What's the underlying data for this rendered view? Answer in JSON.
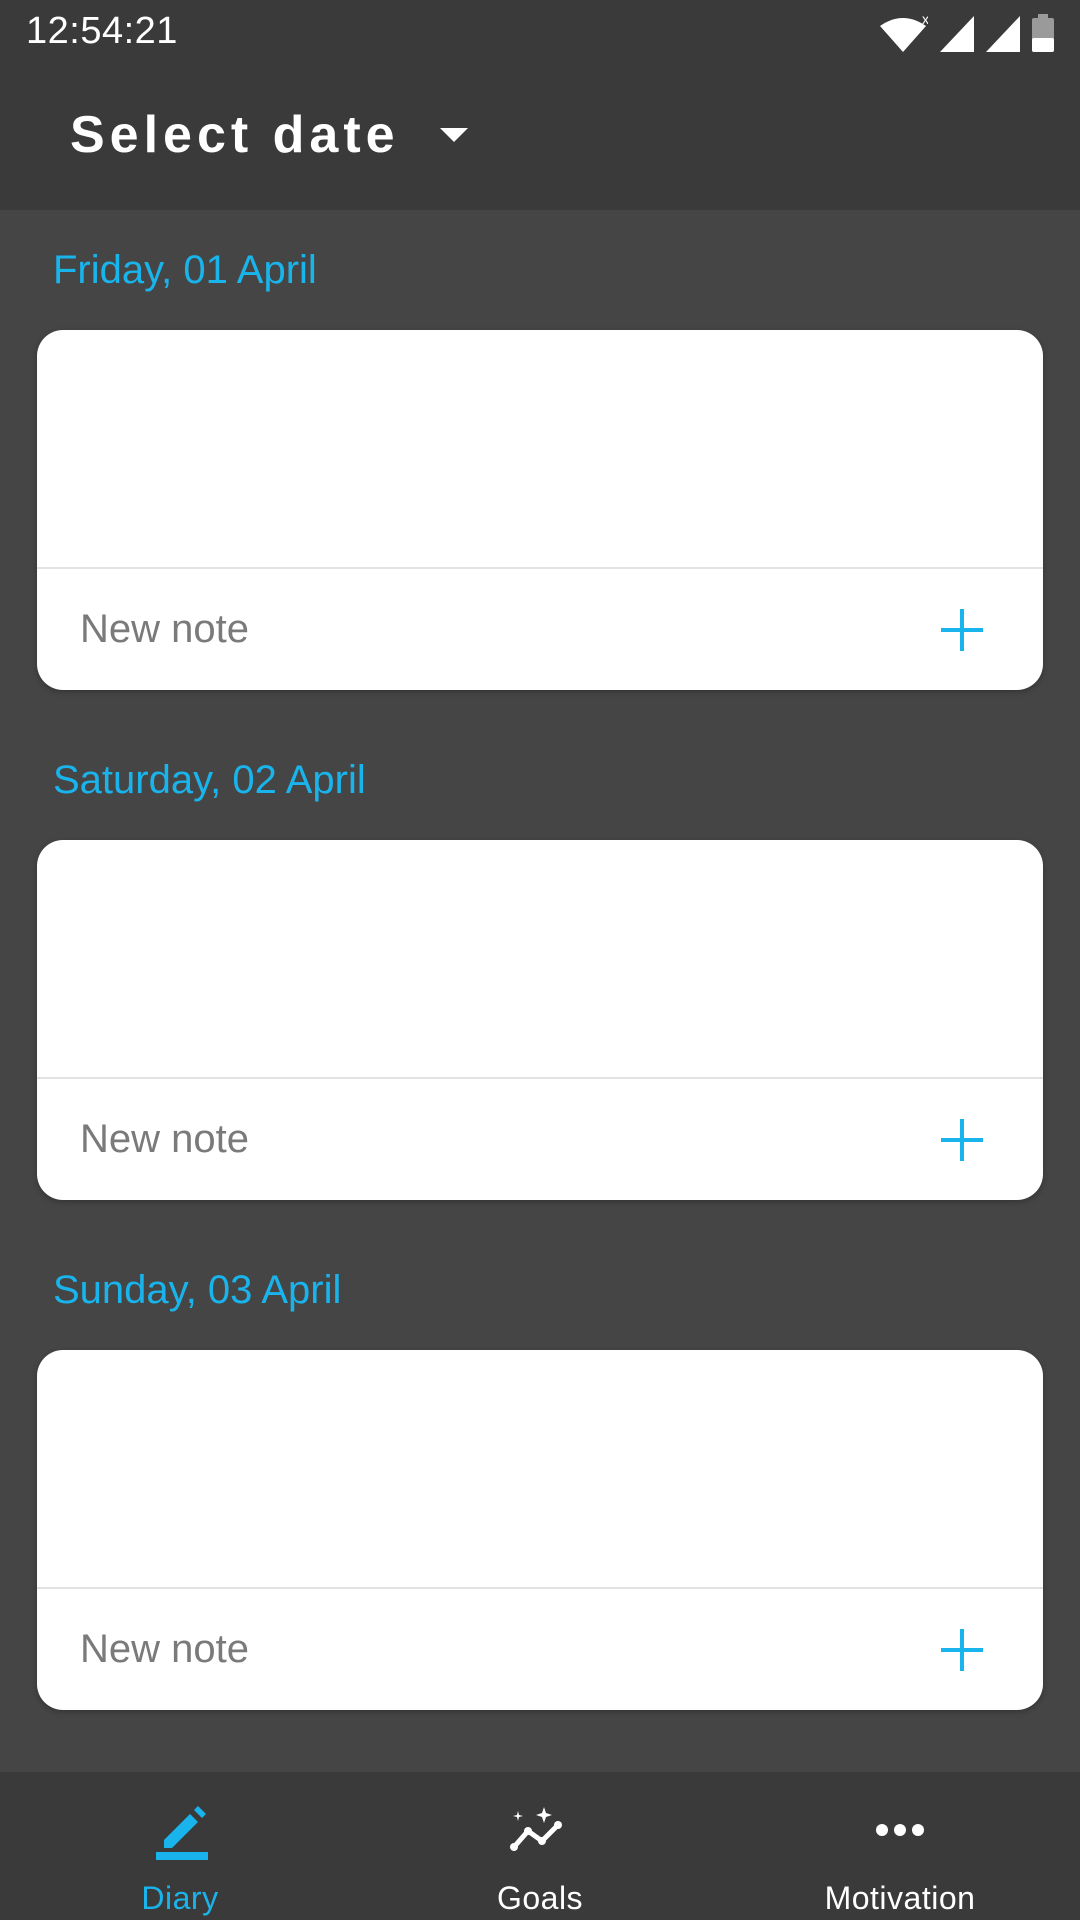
{
  "status_bar": {
    "time": "12:54:21",
    "icons": [
      "wifi-icon",
      "signal-icon",
      "signal-icon",
      "battery-icon"
    ]
  },
  "header": {
    "title": "Select date",
    "dropdown_icon": "dropdown-arrow-icon"
  },
  "days": [
    {
      "date": "Friday, 01 April",
      "new_note_label": "New note"
    },
    {
      "date": "Saturday, 02 April",
      "new_note_label": "New note"
    },
    {
      "date": "Sunday, 03 April",
      "new_note_label": "New note"
    }
  ],
  "bottom_nav": {
    "items": [
      {
        "label": "Diary",
        "icon": "pencil-icon",
        "active": true
      },
      {
        "label": "Goals",
        "icon": "goals-chart-icon",
        "active": false
      },
      {
        "label": "Motivation",
        "icon": "more-dots-icon",
        "active": false
      }
    ]
  },
  "colors": {
    "accent": "#1ab4ec",
    "background": "#454545",
    "bar": "#3a3a3a",
    "card": "#ffffff",
    "muted_text": "#7a7a7a"
  }
}
